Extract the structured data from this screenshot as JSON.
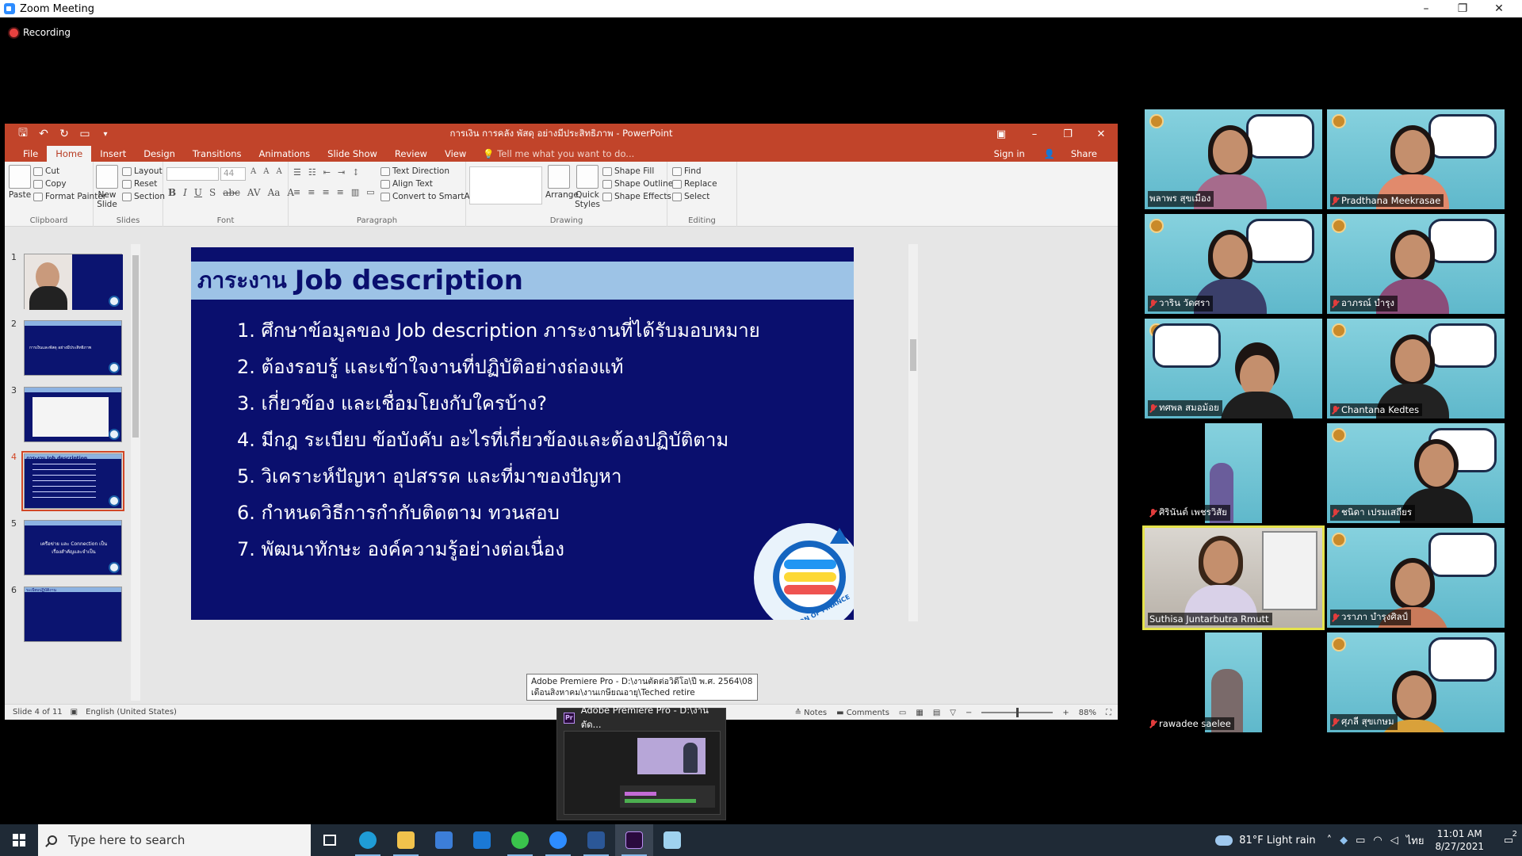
{
  "zoom": {
    "window_title": "Zoom Meeting",
    "recording_label": "Recording",
    "controls": [
      "–",
      "❐",
      "✕"
    ]
  },
  "powerpoint": {
    "window_title": "การเงิน การคลัง พัสดุ อย่างมีประสิทธิภาพ - PowerPoint",
    "tabs": [
      "File",
      "Home",
      "Insert",
      "Design",
      "Transitions",
      "Animations",
      "Slide Show",
      "Review",
      "View"
    ],
    "active_tab": "Home",
    "tell_me": "Tell me what you want to do...",
    "sign_in": "Sign in",
    "share": "Share",
    "ribbon": {
      "clipboard": {
        "label": "Clipboard",
        "paste": "Paste",
        "cut": "Cut",
        "copy": "Copy",
        "format_painter": "Format Painter"
      },
      "slides": {
        "label": "Slides",
        "new_slide": "New Slide",
        "layout": "Layout",
        "reset": "Reset",
        "section": "Section"
      },
      "font": {
        "label": "Font",
        "size": "44"
      },
      "paragraph": {
        "label": "Paragraph",
        "text_direction": "Text Direction",
        "align_text": "Align Text",
        "convert_smartart": "Convert to SmartArt"
      },
      "drawing": {
        "label": "Drawing",
        "arrange": "Arrange",
        "quick_styles": "Quick Styles",
        "shape_fill": "Shape Fill",
        "shape_outline": "Shape Outline",
        "shape_effects": "Shape Effects"
      },
      "editing": {
        "label": "Editing",
        "find": "Find",
        "replace": "Replace",
        "select": "Select"
      }
    },
    "thumbnails": [
      {
        "num": "1",
        "text": ""
      },
      {
        "num": "2",
        "text": "การเงินและพัสดุ อย่างมีประสิทธิภาพ"
      },
      {
        "num": "3",
        "text": ""
      },
      {
        "num": "4",
        "text": "ภาระงาน Job description"
      },
      {
        "num": "5",
        "text": "เครือข่าย และ Connection เป็นเรื่องสำคัญและจำเป็น"
      },
      {
        "num": "6",
        "text": "ระเบียบปฏิบัติงาน"
      }
    ],
    "active_slide_index": 3,
    "slide": {
      "title_th": "ภาระงาน",
      "title_en": "Job description",
      "items": [
        "1. ศึกษาข้อมูลของ Job description ภาระงานที่ได้รับมอบหมาย",
        "2. ต้องรอบรู้ และเข้าใจงานที่ปฏิบัติอย่างถ่องแท้",
        "3. เกี่ยวข้อง และเชื่อมโยงกับใครบ้าง?",
        "4. มีกฎ ระเบียบ ข้อบังคับ อะไรที่เกี่ยวข้องและต้องปฏิบัติตาม",
        "5. วิเคราะห์ปัญหา อุปสรรค และที่มาของปัญหา",
        "6. กำหนดวิธีการกำกับติดตาม ทวนสอบ",
        "7. พัฒนาทักษะ องค์ความรู้อย่างต่อเนื่อง"
      ],
      "logo_text": "DIVISION OF FINANCE"
    },
    "status": {
      "slide_info": "Slide 4 of 11",
      "language": "English (United States)",
      "notes": "Notes",
      "comments": "Comments",
      "zoom": "88%"
    }
  },
  "tooltip": {
    "line1": "Adobe Premiere Pro - D:\\งานตัดต่อวิดีโอ\\ปี พ.ศ. 2564\\08",
    "line2": "เดือนสิงหาคม\\งานเกษียณอายุ\\Teched retire"
  },
  "taskbar_preview": {
    "title": "Adobe Premiere Pro - D:\\งานตัด..."
  },
  "participants": [
    {
      "name": "พลาพร สุขเมือง",
      "muted": false,
      "speaking": false
    },
    {
      "name": "Pradthana Meekrasae",
      "muted": true,
      "speaking": false
    },
    {
      "name": "วาริน วัดศรา",
      "muted": true,
      "speaking": false
    },
    {
      "name": "อาภรณ์ บำรุง",
      "muted": true,
      "speaking": false
    },
    {
      "name": "ทศพล สมอม้อย",
      "muted": true,
      "speaking": false
    },
    {
      "name": "Chantana Kedtes",
      "muted": true,
      "speaking": false
    },
    {
      "name": "ศิรินันต์ เพชรวิสัย",
      "muted": true,
      "speaking": false
    },
    {
      "name": "ชนิดา เปรมเสถียร",
      "muted": true,
      "speaking": false
    },
    {
      "name": "Suthisa Juntarbutra Rmutt",
      "muted": false,
      "speaking": true
    },
    {
      "name": "วราภา บำรุงศิลป์",
      "muted": true,
      "speaking": false
    },
    {
      "name": "rawadee saelee",
      "muted": true,
      "speaking": false
    },
    {
      "name": "ศุภลี สุขเกษม",
      "muted": true,
      "speaking": false
    }
  ],
  "windows": {
    "search_placeholder": "Type here to search",
    "weather": "81°F  Light rain",
    "time": "11:01 AM",
    "date": "8/27/2021",
    "lang": "ไทย",
    "notifications": "2"
  }
}
